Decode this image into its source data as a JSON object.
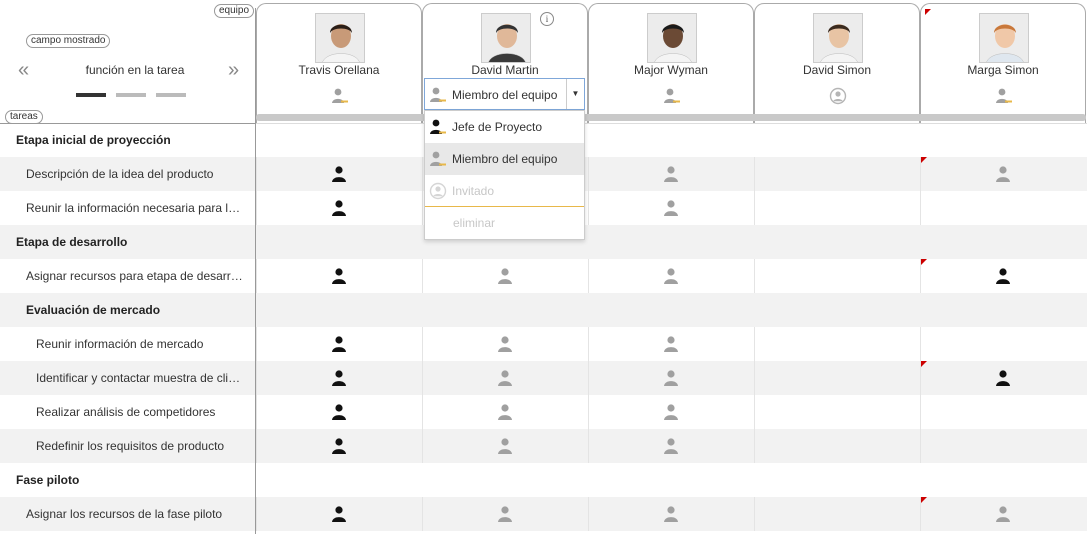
{
  "labels": {
    "team_tag": "equipo",
    "tasks_tag": "tareas",
    "shown_field_tag": "campo mostrado",
    "field_name": "función en la tarea",
    "prev_arrow": "«",
    "next_arrow": "»"
  },
  "members": [
    {
      "name": "Travis Orellana",
      "header_role": "member"
    },
    {
      "name": "David Martin",
      "header_role": "member"
    },
    {
      "name": "Major Wyman",
      "header_role": "member"
    },
    {
      "name": "David Simon",
      "header_role": "guest"
    },
    {
      "name": "Marga Simon",
      "header_role": "member"
    }
  ],
  "dropdown": {
    "selected": "Miembro del equipo",
    "options": [
      {
        "label": "Jefe de Proyecto",
        "role": "leader",
        "state": "normal"
      },
      {
        "label": "Miembro del equipo",
        "role": "member",
        "state": "selected"
      },
      {
        "label": "Invitado",
        "role": "guest",
        "state": "disabled"
      }
    ],
    "remove_label": "eliminar"
  },
  "rows": [
    {
      "type": "phase",
      "label": "Etapa inicial de proyección",
      "indent": 0,
      "cells": [
        null,
        null,
        null,
        null,
        null
      ]
    },
    {
      "type": "task",
      "label": "Descripción de la idea del producto",
      "indent": 1,
      "cells": [
        "leader",
        null,
        "member",
        null,
        "member"
      ]
    },
    {
      "type": "task",
      "label": "Reunir la información necesaria para la toma de decisiones",
      "indent": 1,
      "cells": [
        "leader",
        null,
        "member",
        null,
        null
      ]
    },
    {
      "type": "phase",
      "label": "Etapa de desarrollo",
      "indent": 0,
      "cells": [
        null,
        null,
        null,
        null,
        null
      ]
    },
    {
      "type": "task",
      "label": "Asignar recursos para etapa de desarrollo",
      "indent": 1,
      "cells": [
        "leader",
        "member",
        "member",
        null,
        "leader"
      ]
    },
    {
      "type": "phase",
      "label": "Evaluación de mercado",
      "indent": 1,
      "cells": [
        null,
        null,
        null,
        null,
        null
      ]
    },
    {
      "type": "task",
      "label": "Reunir información de mercado",
      "indent": 2,
      "cells": [
        "leader",
        "member",
        "member",
        null,
        null
      ]
    },
    {
      "type": "task",
      "label": "Identificar y contactar muestra de clientes",
      "indent": 2,
      "cells": [
        "leader",
        "member",
        "member",
        null,
        "leader"
      ]
    },
    {
      "type": "task",
      "label": "Realizar análisis de competidores",
      "indent": 2,
      "cells": [
        "leader",
        "member",
        "member",
        null,
        null
      ]
    },
    {
      "type": "task",
      "label": "Redefinir los requisitos de producto",
      "indent": 2,
      "cells": [
        "leader",
        "member",
        "member",
        null,
        null
      ]
    },
    {
      "type": "phase",
      "label": "Fase piloto",
      "indent": 0,
      "cells": [
        null,
        null,
        null,
        null,
        null
      ]
    },
    {
      "type": "task",
      "label": "Asignar los recursos de la fase piloto",
      "indent": 1,
      "cells": [
        "leader",
        "member",
        "member",
        null,
        "member"
      ]
    }
  ],
  "icons": {
    "leader": "leader-role-icon",
    "member": "member-role-icon",
    "guest": "guest-role-icon",
    "info": "info-icon",
    "modified_marker": "red-corner-marker"
  },
  "colors": {
    "leader": "#111111",
    "member": "#a0a0a0",
    "guest": "#b5b5b5",
    "accent_yellow": "#e8b84a",
    "marker_red": "#cc0000",
    "focus_blue": "#7fa7d9"
  }
}
